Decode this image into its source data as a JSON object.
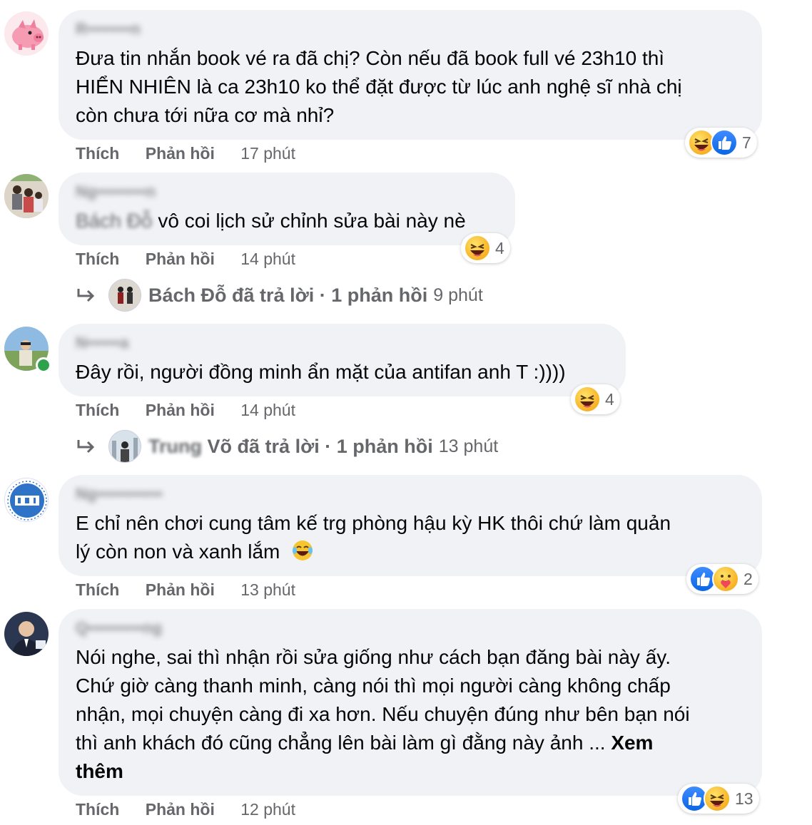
{
  "comments": [
    {
      "author": "R••••••••n",
      "lines": [
        "Đưa tin nhắn book vé ra đã chị? Còn nếu đã book full vé 23h10 thì",
        "HIỂN NHIÊN là ca 23h10 ko thể đặt được từ lúc anh nghệ sĩ nhà chị",
        "còn chưa tới nữa cơ mà nhỉ?"
      ],
      "like_label": "Thích",
      "reply_label": "Phản hồi",
      "time": "17 phút",
      "reactions": [
        "haha",
        "like"
      ],
      "reaction_count": "7"
    },
    {
      "author": "Ng•••••••••n",
      "lines": [
        "vô coi lịch sử chỉnh sửa bài này nè"
      ],
      "tag_blur": "Bách Đỗ",
      "like_label": "Thích",
      "reply_label": "Phản hồi",
      "time": "14 phút",
      "reactions": [
        "haha"
      ],
      "reaction_count": "4",
      "reply_summary": {
        "name": "Bách Đỗ",
        "text": "đã trả lời · 1 phản hồi",
        "time": "9 phút"
      }
    },
    {
      "author": "N••••••a",
      "lines": [
        "Đây rồi, người đồng minh ẩn mặt của antifan anh T :))))"
      ],
      "like_label": "Thích",
      "reply_label": "Phản hồi",
      "time": "14 phút",
      "reactions": [
        "haha"
      ],
      "reaction_count": "4",
      "reply_summary": {
        "name_blur": "Trung",
        "name": "Võ",
        "text": "đã trả lời · 1 phản hồi",
        "time": "13 phút"
      }
    },
    {
      "author": "Ng••••••••••••",
      "lines": [
        "E chỉ nên chơi cung tâm kế trg phòng hậu kỳ HK thôi chứ làm quản",
        "lý còn non và xanh lắm"
      ],
      "like_label": "Thích",
      "reply_label": "Phản hồi",
      "time": "13 phút",
      "reactions": [
        "like",
        "care"
      ],
      "reaction_count": "2"
    },
    {
      "author": "Q••••••••••ng",
      "lines": [
        "Nói nghe, sai thì nhận rồi sửa giống như cách bạn đăng bài này ấy.",
        "Chứ giờ càng thanh minh, càng nói thì mọi người càng không chấp",
        "nhận, mọi chuyện càng đi xa hơn. Nếu chuyện đúng như bên bạn nói",
        "thì anh khách đó cũng chẳng lên bài làm gì đằng này ảnh ... "
      ],
      "see_more_1": "Xem",
      "see_more_2": "thêm",
      "like_label": "Thích",
      "reply_label": "Phản hồi",
      "time": "12 phút",
      "reactions": [
        "like",
        "haha"
      ],
      "reaction_count": "13"
    }
  ],
  "colors": {
    "bubble": "#f0f2f5",
    "meta": "#65676b",
    "like_blue": "#1877f2",
    "online": "#31a24c"
  }
}
